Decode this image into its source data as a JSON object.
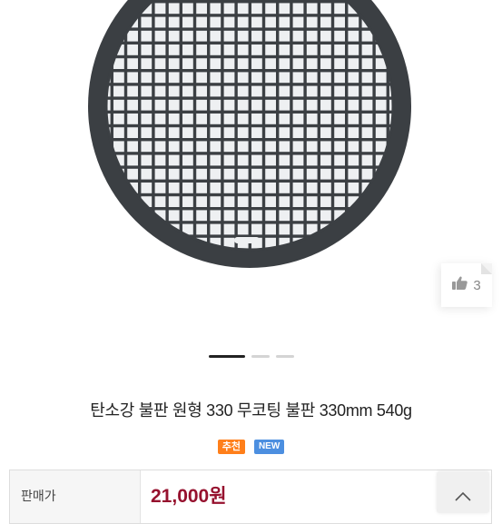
{
  "product": {
    "title": "탄소강 불판 원형 330 무코팅 불판 330mm 540g",
    "like_count": "3",
    "tags": {
      "recommend": "추천",
      "new": "NEW"
    },
    "price_label": "판매가",
    "price": "21,000원"
  },
  "gallery": {
    "slide_count": 3,
    "active_slide": 1
  },
  "icons": {
    "like": "thumbs-up-icon",
    "scroll_top": "chevron-up-icon"
  },
  "colors": {
    "price": "#96112e",
    "tag_recommend": "#ff7f1a",
    "tag_new": "#4c8fe0",
    "grill": "#3b3f43"
  }
}
